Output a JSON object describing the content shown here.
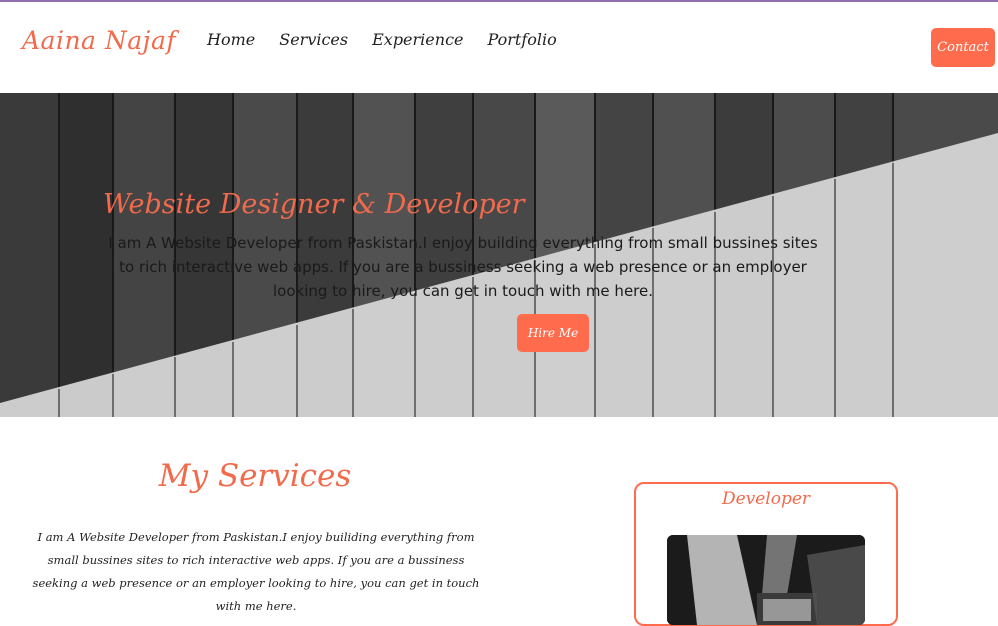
{
  "navbar": {
    "brand": "Aaina Najaf",
    "links": [
      "Home",
      "Services",
      "Experience",
      "Portfolio"
    ],
    "contact_label": "Contact"
  },
  "hero": {
    "title": "Website Designer & Developer",
    "description": "I am A Website Developer from Paskistan.I enjoy building everything from small bussines sites to rich interactive web apps. If you are a bussiness seeking a web presence or an employer looking to hire, you can get in touch with me here.",
    "button_label": "Hire Me"
  },
  "services": {
    "title": "My Services",
    "description": "I am A Website Developer from Paskistan.I enjoy builiding everything from small bussines sites to rich interactive web apps. If you are a bussiness seeking a web presence or an employer looking to hire, you can get in touch with me here.",
    "card": {
      "title": "Developer"
    }
  },
  "colors": {
    "accent": "#ff6b4d",
    "accent_text": "#f26a4c",
    "top_border": "#8f6fae"
  }
}
